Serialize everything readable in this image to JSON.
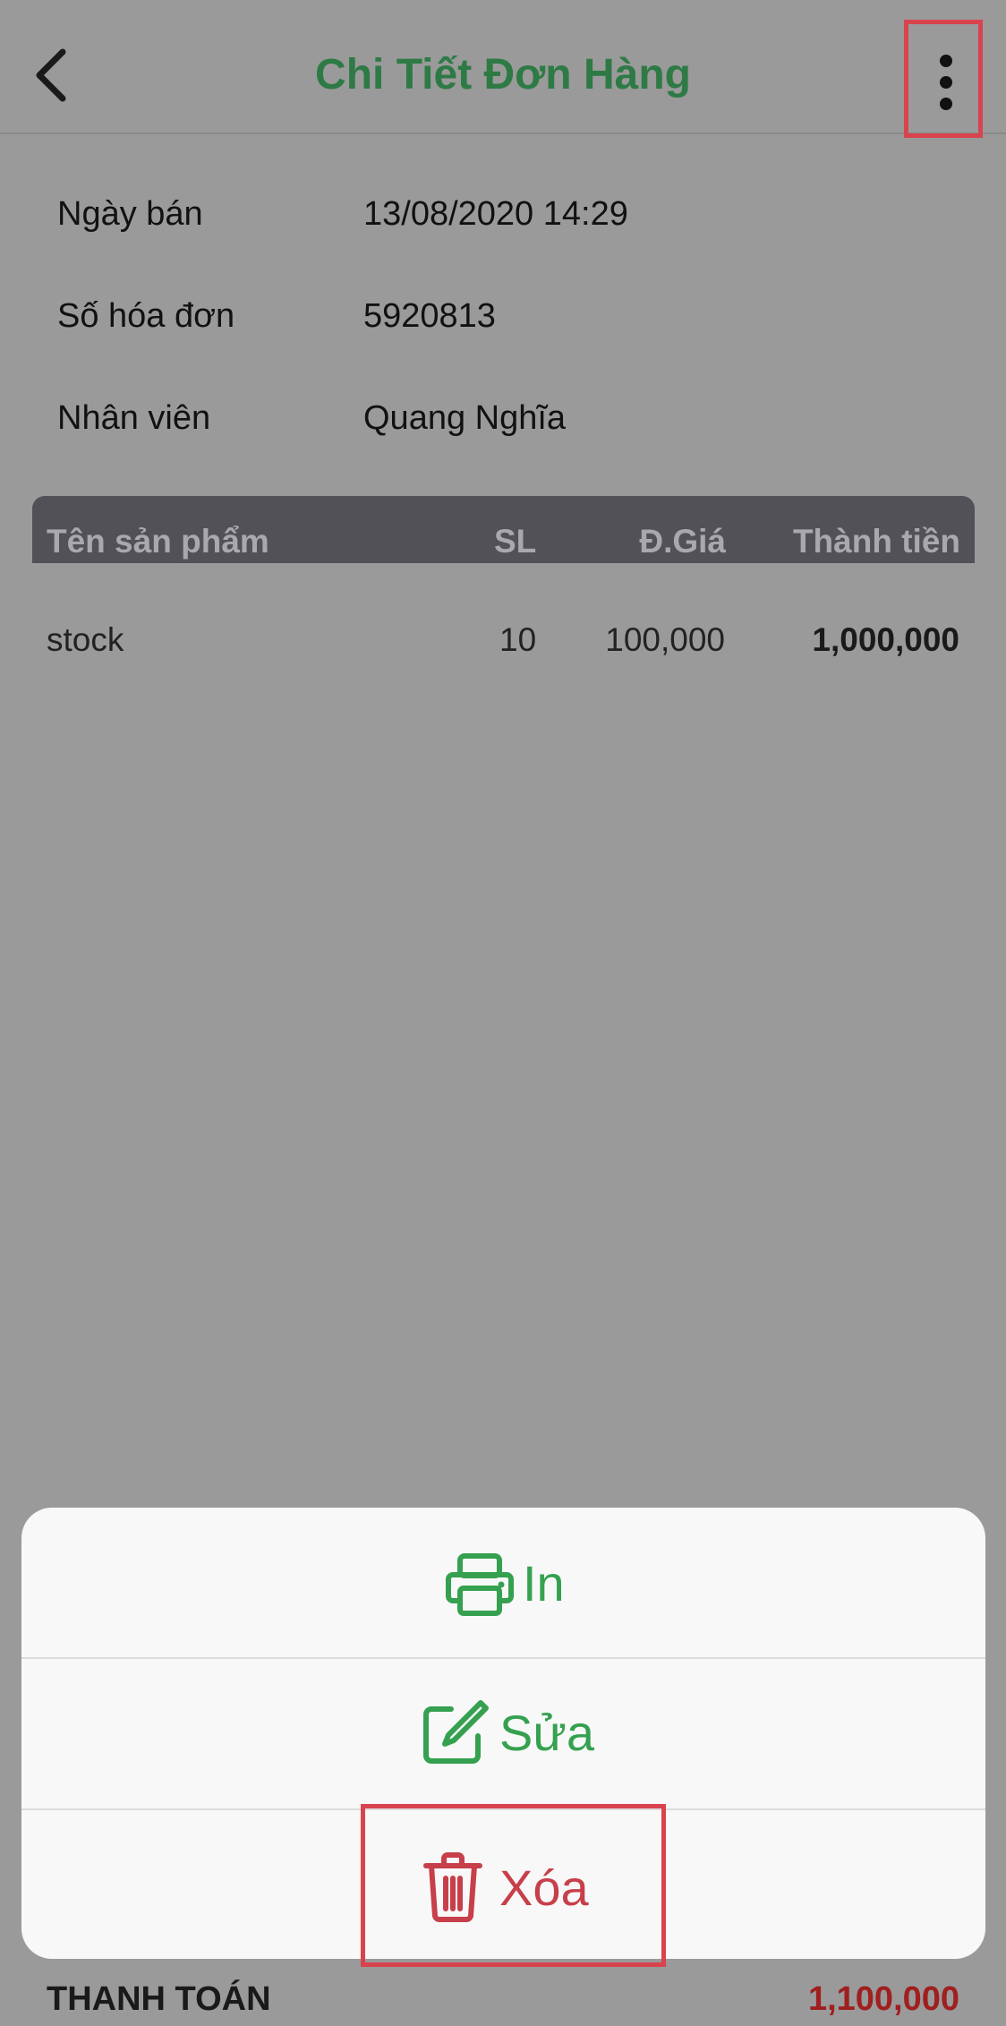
{
  "header": {
    "title": "Chi Tiết Đơn Hàng"
  },
  "info": {
    "sale_date_label": "Ngày bán",
    "sale_date_value": "13/08/2020 14:29",
    "invoice_label": "Số hóa đơn",
    "invoice_value": "5920813",
    "staff_label": "Nhân viên",
    "staff_value": "Quang Nghĩa"
  },
  "table": {
    "columns": [
      "Tên sản phẩm",
      "SL",
      "Đ.Giá",
      "Thành tiền"
    ],
    "rows": [
      {
        "name": "stock",
        "qty": "10",
        "price": "100,000",
        "total": "1,000,000"
      }
    ]
  },
  "action_sheet": {
    "print_label": "In",
    "edit_label": "Sửa",
    "delete_label": "Xóa"
  },
  "footer": {
    "payment_label": "THANH TOÁN",
    "payment_value": "1,100,000"
  },
  "colors": {
    "brand_green": "#35a150",
    "title_green": "#2e7a45",
    "danger_red": "#c73f4a",
    "highlight": "#d9434e"
  },
  "icons": [
    "chevron-left-icon",
    "more-vertical-icon",
    "printer-icon",
    "edit-icon",
    "trash-icon"
  ]
}
